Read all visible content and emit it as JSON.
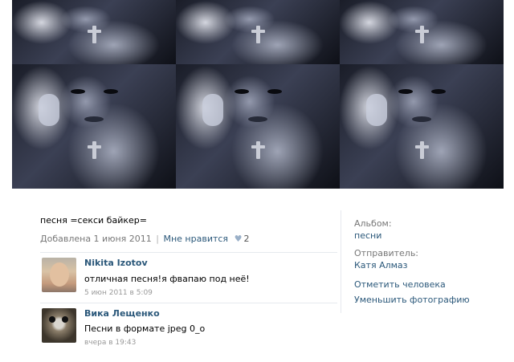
{
  "photo": {
    "description_icon": "photo-collage"
  },
  "post": {
    "title": "песня =секси байкер=",
    "added": "Добавлена 1 июня 2011",
    "separator": "|",
    "like_label": "Мне нравится",
    "like_count": "2"
  },
  "comments": [
    {
      "author": "Nikita Izotov",
      "text": "отличная песня!я фвапаю под неё!",
      "date": "5 июн 2011 в 5:09"
    },
    {
      "author": "Вика Лещенко",
      "text": "Песни в формате jpeg 0_o",
      "date": "вчера в 19:43"
    }
  ],
  "sidebar": {
    "album_label": "Альбом:",
    "album_value": "песни",
    "sender_label": "Отправитель:",
    "sender_value": "Катя Алмаз",
    "tag_action": "Отметить человека",
    "shrink_action": "Уменьшить фотографию"
  },
  "colors": {
    "link": "#2b587a",
    "muted": "#777777",
    "divider": "#e6e9ee"
  }
}
